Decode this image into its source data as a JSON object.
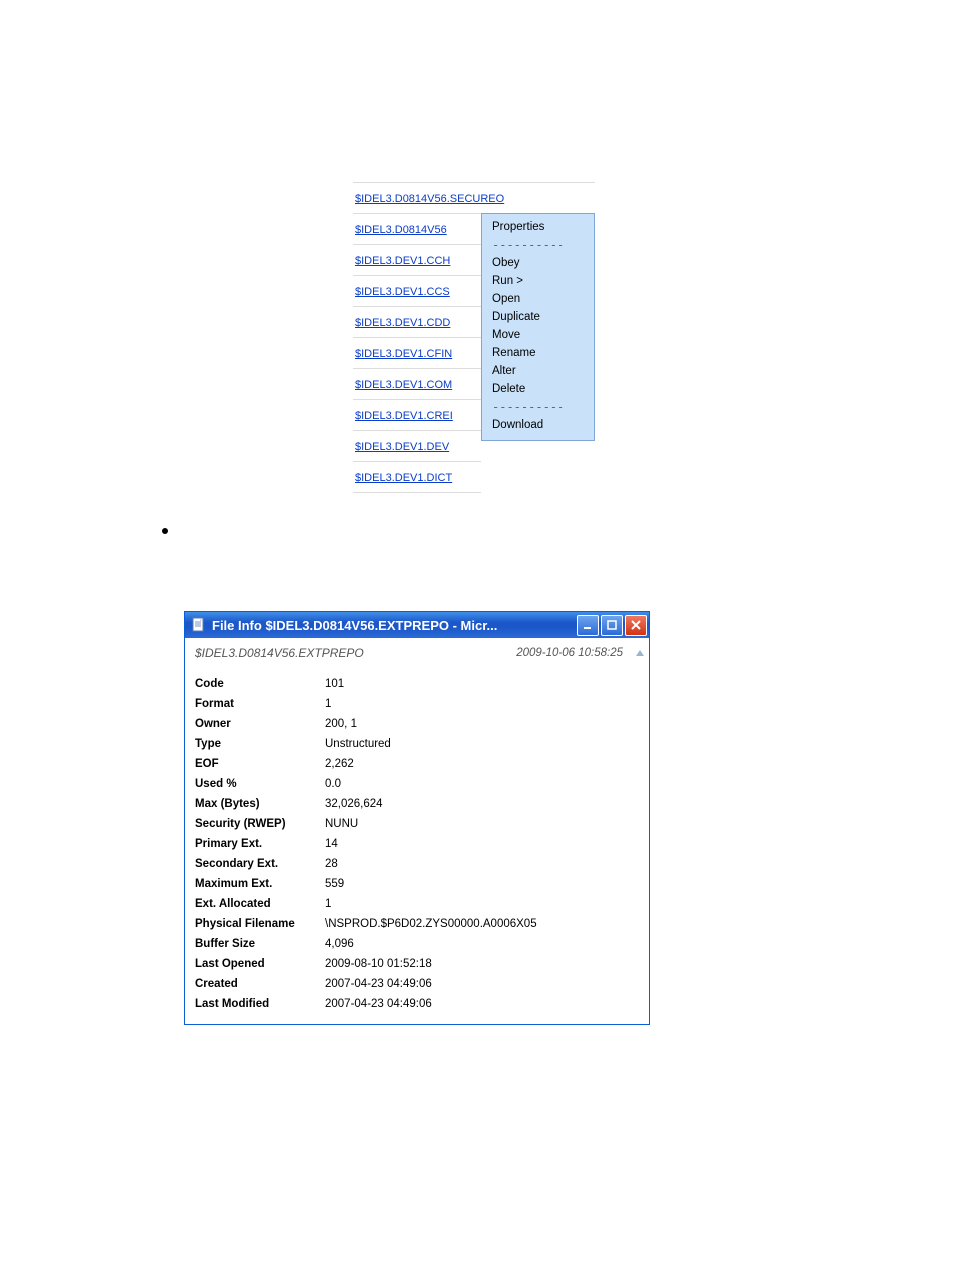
{
  "file_list": {
    "header_link": "$IDEL3.D0814V56.SECUREO",
    "rows": [
      "$IDEL3.D0814V56",
      "$IDEL3.DEV1.CCH",
      "$IDEL3.DEV1.CCS",
      "$IDEL3.DEV1.CDD",
      "$IDEL3.DEV1.CFIN",
      "$IDEL3.DEV1.COM",
      "$IDEL3.DEV1.CREI",
      "$IDEL3.DEV1.DEV",
      "$IDEL3.DEV1.DICT"
    ]
  },
  "context_menu": {
    "properties": "Properties",
    "divider": "----------",
    "obey": "Obey",
    "run": "Run >",
    "open": "Open",
    "duplicate": "Duplicate",
    "move": "Move",
    "rename": "Rename",
    "alter": "Alter",
    "delete": "Delete",
    "download": "Download"
  },
  "properties_window": {
    "title": "File Info $IDEL3.D0814V56.EXTPREPO - Micr...",
    "header_name": "$IDEL3.D0814V56.EXTPREPO",
    "header_timestamp": "2009-10-06 10:58:25",
    "fields": [
      {
        "label": "Code",
        "value": "101"
      },
      {
        "label": "Format",
        "value": "1"
      },
      {
        "label": "Owner",
        "value": "200, 1"
      },
      {
        "label": "Type",
        "value": "Unstructured"
      },
      {
        "label": "EOF",
        "value": "2,262"
      },
      {
        "label": "Used %",
        "value": "0.0"
      },
      {
        "label": "Max (Bytes)",
        "value": "32,026,624"
      },
      {
        "label": "Security (RWEP)",
        "value": "NUNU"
      },
      {
        "label": "Primary Ext.",
        "value": "14"
      },
      {
        "label": "Secondary Ext.",
        "value": "28"
      },
      {
        "label": "Maximum Ext.",
        "value": "559"
      },
      {
        "label": "Ext. Allocated",
        "value": "1"
      },
      {
        "label": "Physical Filename",
        "value": "\\NSPROD.$P6D02.ZYS00000.A0006X05"
      },
      {
        "label": "Buffer Size",
        "value": "4,096"
      },
      {
        "label": "Last Opened",
        "value": "2009-08-10 01:52:18"
      },
      {
        "label": "Created",
        "value": "2007-04-23 04:49:06"
      },
      {
        "label": "Last Modified",
        "value": "2007-04-23 04:49:06"
      }
    ]
  }
}
